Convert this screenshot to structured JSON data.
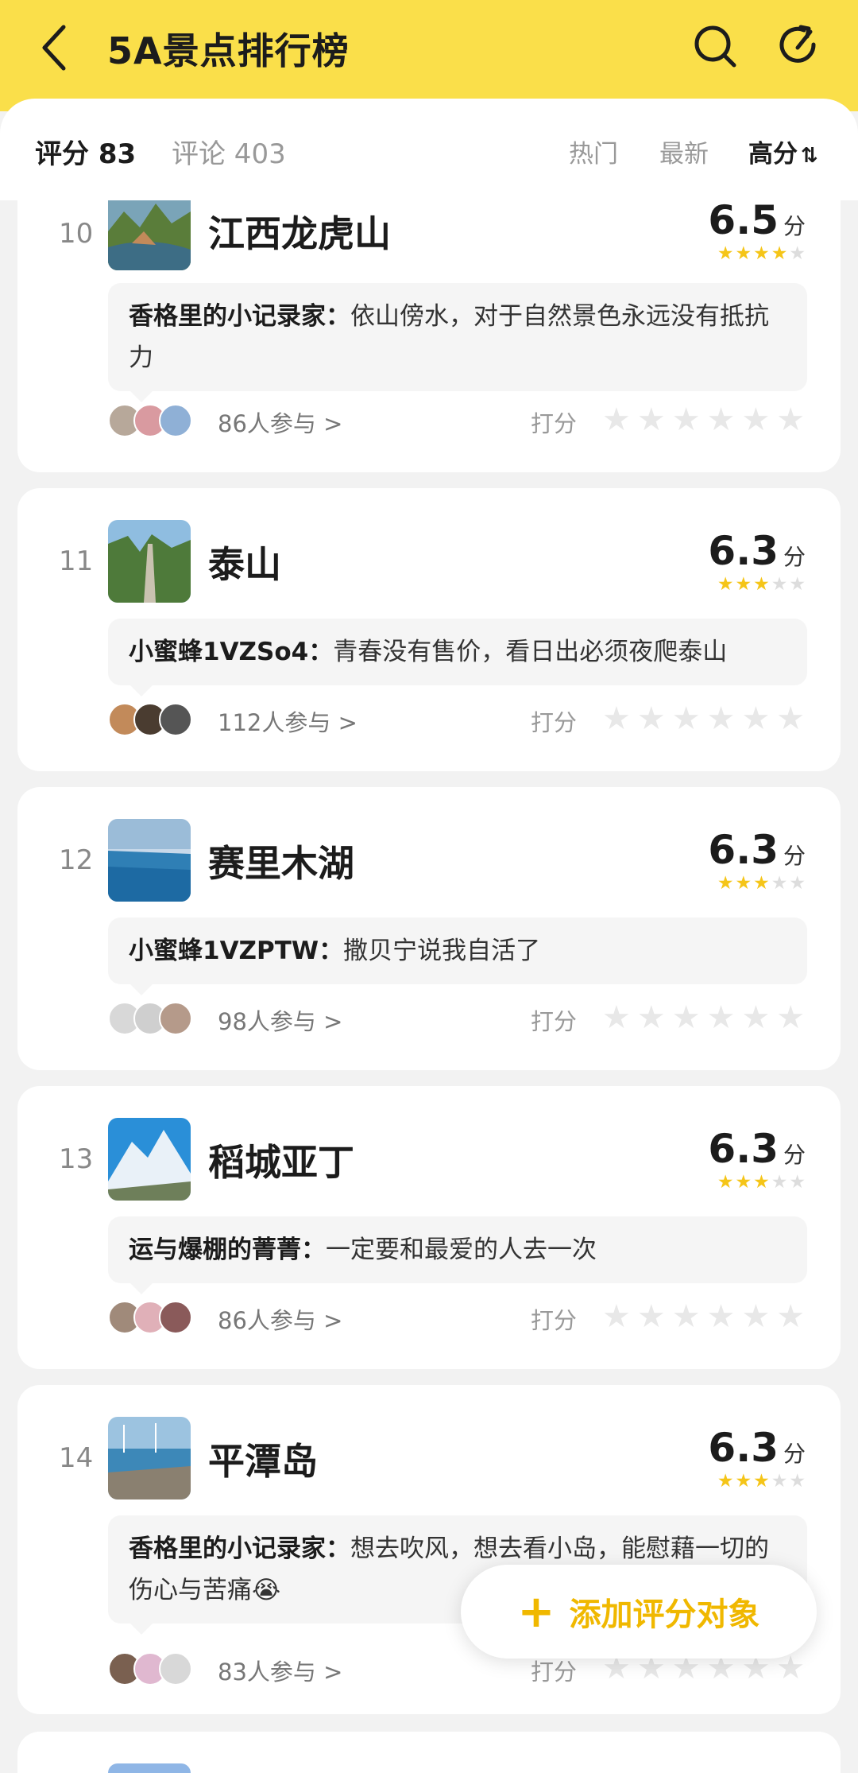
{
  "header": {
    "title": "5A景点排行榜",
    "bg_color": "#fadf4a",
    "icons": [
      "back-arrow-icon",
      "search-icon",
      "share-icon"
    ]
  },
  "stats": {
    "score": "评分 83",
    "comments": "评论 403"
  },
  "tabs": [
    {
      "label": "热门",
      "active": false
    },
    {
      "label": "最新",
      "active": false
    },
    {
      "label": "高分",
      "active": true,
      "sort_icon": "⇅"
    }
  ],
  "rate_label": "打分",
  "items": [
    {
      "rank": "10",
      "name": "江西龙虎山",
      "score": "6.5",
      "unit": "分",
      "stars": 3.5,
      "comment_author": "香格里的小记录家：",
      "comment_text": "依山傍水，对于自然景色永远没有抵抗力",
      "participants": "86人参与 >"
    },
    {
      "rank": "11",
      "name": "泰山",
      "score": "6.3",
      "unit": "分",
      "stars": 3,
      "comment_author": "小蜜蜂1VZSo4：",
      "comment_text": "青春没有售价，看日出必须夜爬泰山",
      "participants": "112人参与 >"
    },
    {
      "rank": "12",
      "name": "赛里木湖",
      "score": "6.3",
      "unit": "分",
      "stars": 3,
      "comment_author": "小蜜蜂1VZPTW：",
      "comment_text": "撒贝宁说我自活了",
      "participants": "98人参与 >"
    },
    {
      "rank": "13",
      "name": "稻城亚丁",
      "score": "6.3",
      "unit": "分",
      "stars": 3,
      "comment_author": "运与爆棚的菁菁：",
      "comment_text": "一定要和最爱的人去一次",
      "participants": "86人参与 >"
    },
    {
      "rank": "14",
      "name": "平潭岛",
      "score": "6.3",
      "unit": "分",
      "stars": 3,
      "comment_author": "香格里的小记录家：",
      "comment_text": "想去吹风，想去看小岛，能慰藉一切的伤心与苦痛😭",
      "participants": "83人参与 >"
    }
  ],
  "add_button": {
    "plus": "+",
    "label": "添加评分对象"
  },
  "colors": {
    "star_on": "#f5c518",
    "accent": "#f0b800"
  }
}
